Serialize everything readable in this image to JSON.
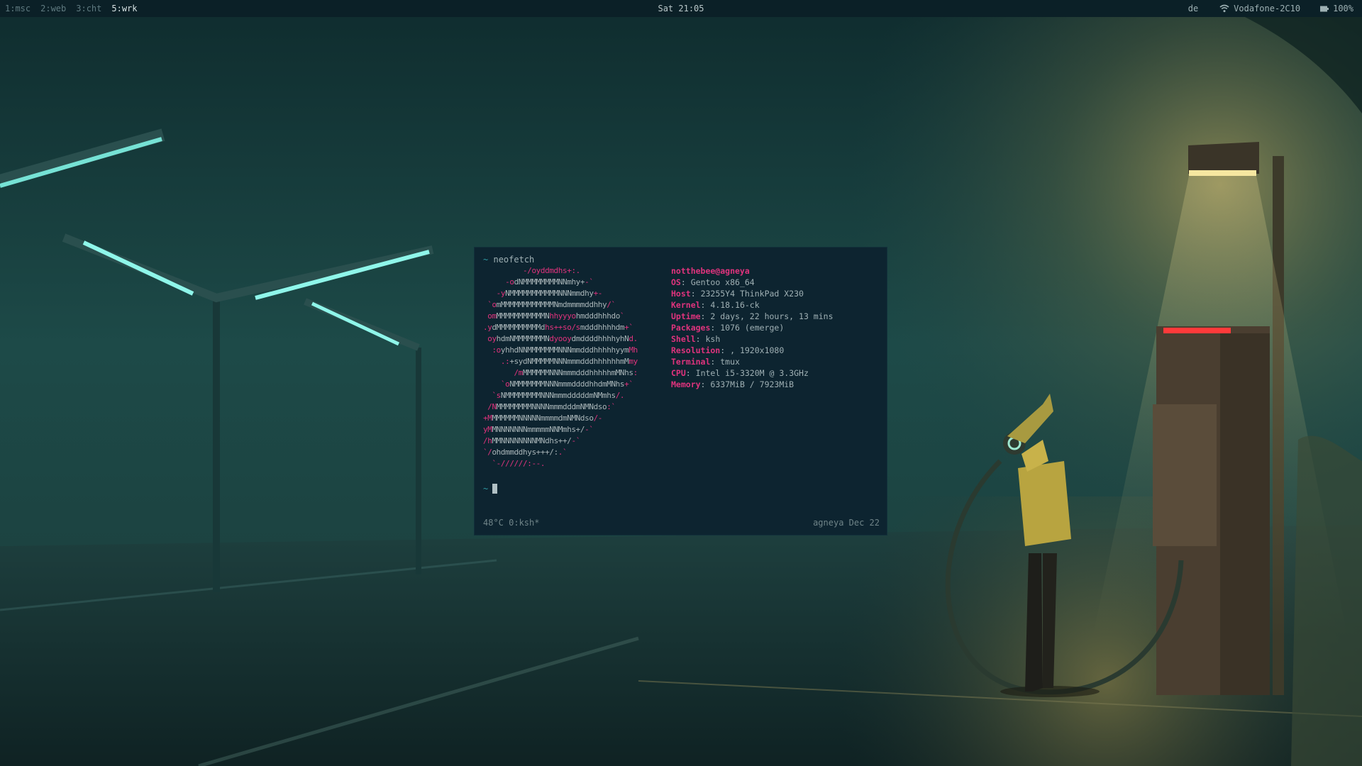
{
  "topbar": {
    "workspaces": [
      {
        "label": "1:msc",
        "active": false
      },
      {
        "label": "2:web",
        "active": false
      },
      {
        "label": "3:cht",
        "active": false
      },
      {
        "label": "5:wrk",
        "active": true
      }
    ],
    "clock": "Sat 21:05",
    "keyboard_layout": "de",
    "wifi_icon": "wifi-icon",
    "network_name": "Vodafone-2C10",
    "battery_icon": "battery-icon",
    "battery_level": "100%"
  },
  "terminal": {
    "prompt_symbol": "~",
    "command": "neofetch",
    "ascii_art": [
      [
        [
          "p",
          "         -/oyddmdhs+:."
        ]
      ],
      [
        [
          "p",
          "     -o"
        ],
        [
          "g",
          "dNMMMMMMMMNNmhy+"
        ],
        [
          "p",
          "-`"
        ]
      ],
      [
        [
          "p",
          "   -y"
        ],
        [
          "g",
          "NMMMMMMMMMMMNNNmmdhy"
        ],
        [
          "p",
          "+-"
        ]
      ],
      [
        [
          "p",
          " `o"
        ],
        [
          "g",
          "mMMMMMMMMMMMMNmdmmmmddhhy"
        ],
        [
          "p",
          "/`"
        ]
      ],
      [
        [
          "p",
          " om"
        ],
        [
          "g",
          "MMMMMMMMMMMN"
        ],
        [
          "p",
          "hhyyyo"
        ],
        [
          "g",
          "hmdddhhhdo"
        ],
        [
          "p",
          "`"
        ]
      ],
      [
        [
          "p",
          ".y"
        ],
        [
          "g",
          "dMMMMMMMMMMd"
        ],
        [
          "p",
          "hs++so/s"
        ],
        [
          "g",
          "mdddhhhhdm"
        ],
        [
          "p",
          "+`"
        ]
      ],
      [
        [
          "p",
          " oy"
        ],
        [
          "g",
          "hdmNMMMMMMMN"
        ],
        [
          "p",
          "dyooy"
        ],
        [
          "g",
          "dmddddhhhhyhN"
        ],
        [
          "p",
          "d."
        ]
      ],
      [
        [
          "p",
          "  :o"
        ],
        [
          "g",
          "yhhdNNMMMMMMMNNNmmdddhhhhhyym"
        ],
        [
          "p",
          "Mh"
        ]
      ],
      [
        [
          "p",
          "    .:"
        ],
        [
          "g",
          "+sydNMMMMMNNNmmmdddhhhhhhmM"
        ],
        [
          "p",
          "my"
        ]
      ],
      [
        [
          "p",
          "       /m"
        ],
        [
          "g",
          "MMMMMMNNNmmmdddhhhhhmMNhs"
        ],
        [
          "p",
          ":"
        ]
      ],
      [
        [
          "p",
          "    `o"
        ],
        [
          "g",
          "NMMMMMMMNNNmmmddddhhdmMNhs"
        ],
        [
          "p",
          "+`"
        ]
      ],
      [
        [
          "p",
          "  `s"
        ],
        [
          "g",
          "NMMMMMMMMNNNmmmdddddmNMmhs"
        ],
        [
          "p",
          "/."
        ]
      ],
      [
        [
          "p",
          " /N"
        ],
        [
          "g",
          "MMMMMMMMNNNNmmmdddmNMNdso"
        ],
        [
          "p",
          ":`"
        ]
      ],
      [
        [
          "p",
          "+M"
        ],
        [
          "g",
          "MMMMMMNNNNNmmmmdmNMNdso"
        ],
        [
          "p",
          "/-"
        ]
      ],
      [
        [
          "p",
          "yM"
        ],
        [
          "g",
          "MNNNNNNNmmmmmNNMmhs+/"
        ],
        [
          "p",
          "-`"
        ]
      ],
      [
        [
          "p",
          "/h"
        ],
        [
          "g",
          "MMNNNNNNNNMNdhs++/"
        ],
        [
          "p",
          "-`"
        ]
      ],
      [
        [
          "p",
          "`/"
        ],
        [
          "g",
          "ohdmmddhys+++/:"
        ],
        [
          "p",
          ".`"
        ]
      ],
      [
        [
          "p",
          "  `-//////:--."
        ]
      ]
    ],
    "user_host": "notthebee@agneya",
    "info": [
      {
        "key": "OS",
        "value": "Gentoo x86_64"
      },
      {
        "key": "Host",
        "value": "23255Y4 ThinkPad X230"
      },
      {
        "key": "Kernel",
        "value": "4.18.16-ck"
      },
      {
        "key": "Uptime",
        "value": "2 days, 22 hours, 13 mins"
      },
      {
        "key": "Packages",
        "value": "1076 (emerge)"
      },
      {
        "key": "Shell",
        "value": "ksh"
      },
      {
        "key": "Resolution",
        "value": ", 1920x1080"
      },
      {
        "key": "Terminal",
        "value": "tmux"
      },
      {
        "key": "CPU",
        "value": "Intel i5-3320M @ 3.3GHz"
      },
      {
        "key": "Memory",
        "value": "6337MiB / 7923MiB"
      }
    ],
    "tmux_left": "48°C 0:ksh*",
    "tmux_right": "agneya Dec 22"
  },
  "colors": {
    "accent_pink": "#e0337d",
    "prompt_cyan": "#2f9aa4",
    "terminal_bg": "#0d2430",
    "topbar_bg": "#0b2027"
  }
}
